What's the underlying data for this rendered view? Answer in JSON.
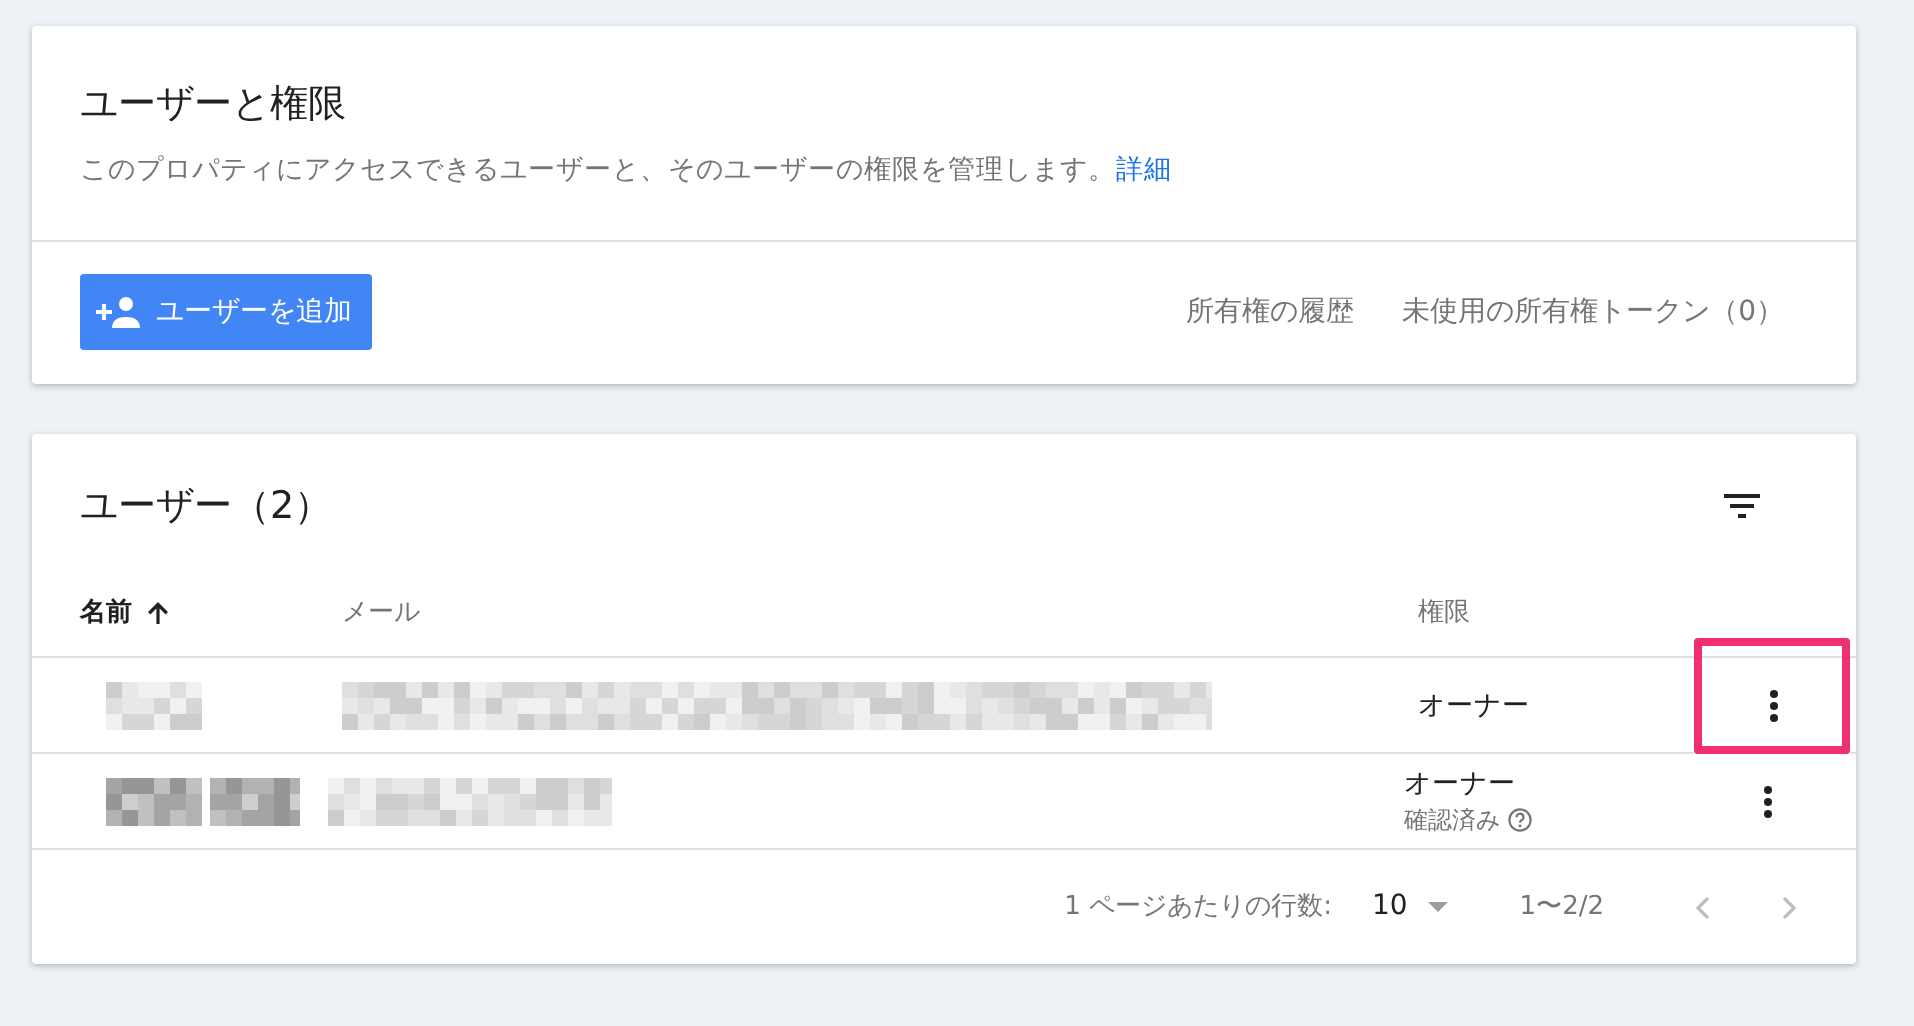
{
  "header_card": {
    "title": "ユーザーと権限",
    "description": "このプロパティにアクセスできるユーザーと、そのユーザーの権限を管理します。",
    "description_link": "詳細",
    "add_user_button": "ユーザーを追加",
    "links": [
      "所有権の履歴",
      "未使用の所有権トークン（0）"
    ]
  },
  "users_card": {
    "title": "ユーザー（2）",
    "columns": [
      {
        "label": "名前",
        "sorted": true
      },
      {
        "label": "メール",
        "sorted": false
      },
      {
        "label": "権限",
        "sorted": false
      }
    ],
    "rows": [
      {
        "role": "オーナー",
        "highlighted": true
      },
      {
        "role": "オーナー",
        "status": "確認済み",
        "highlighted": false
      }
    ],
    "pagination": {
      "rows_per_page_label": "1 ページあたりの行数:",
      "rows_per_page": "10",
      "range": "1〜2/2"
    }
  }
}
